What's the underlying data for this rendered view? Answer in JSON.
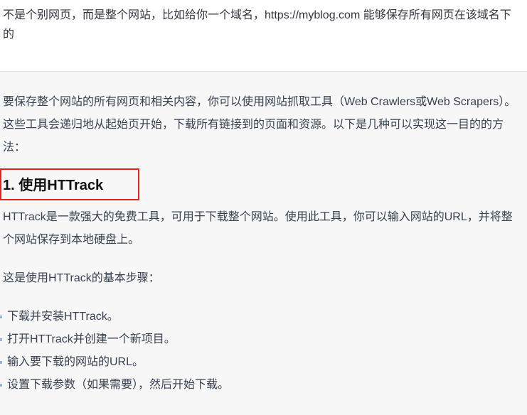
{
  "user_message": {
    "text": "不是个别网页，而是整个网站，比如给你一个域名，https://myblog.com 能够保存所有网页在该域名下的"
  },
  "response": {
    "intro": "要保存整个网站的所有网页和相关内容，你可以使用网站抓取工具（Web Crawlers或Web Scrapers）。这些工具会递归地从起始页开始，下载所有链接到的页面和资源。以下是几种可以实现这一目的的方法：",
    "heading": "1. 使用HTTrack",
    "description": "HTTrack是一款强大的免费工具，可用于下载整个网站。使用此工具，你可以输入网站的URL，并将整个网站保存到本地硬盘上。",
    "steps_intro": "这是使用HTTrack的基本步骤：",
    "steps": [
      "下载并安装HTTrack。",
      "打开HTTrack并创建一个新项目。",
      "输入要下载的网站的URL。",
      "设置下载参数（如果需要），然后开始下载。"
    ]
  },
  "colors": {
    "highlight_box": "#e02424",
    "response_bg": "#f7f7f8"
  }
}
